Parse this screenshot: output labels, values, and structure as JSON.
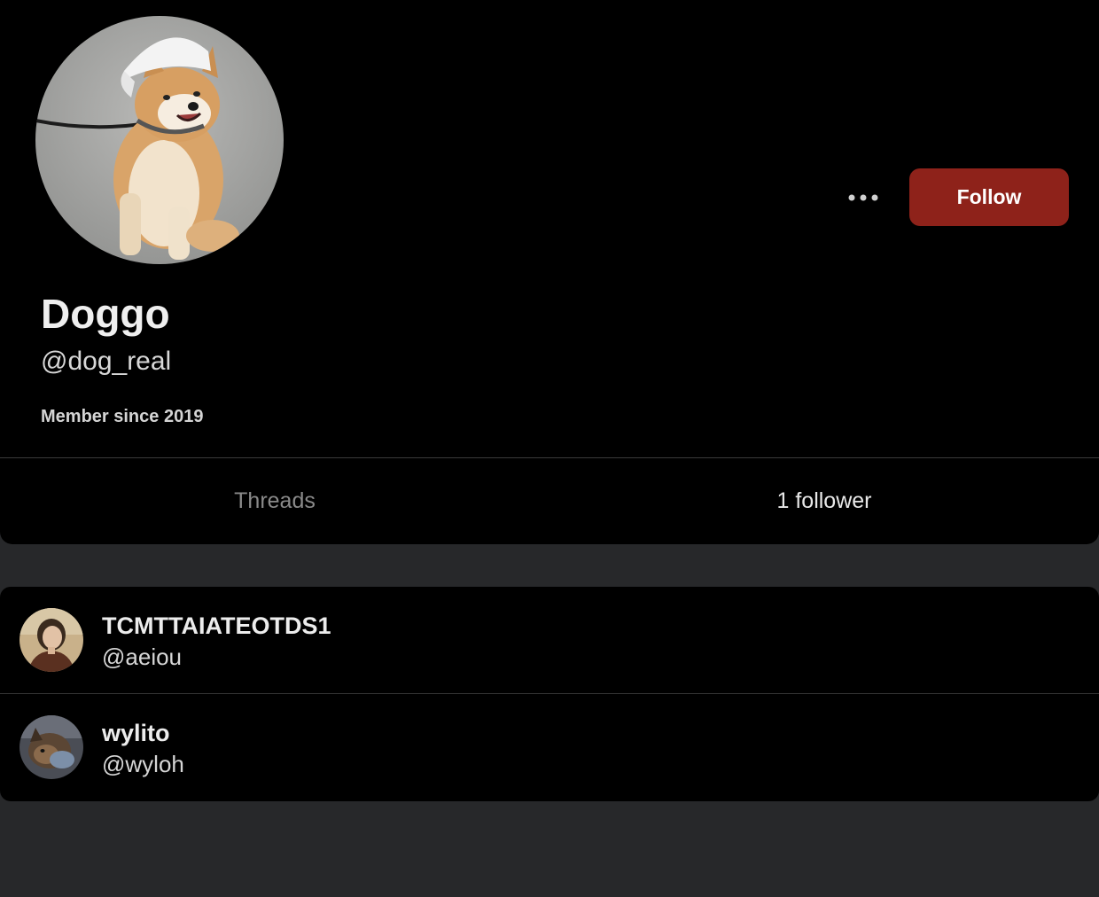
{
  "profile": {
    "avatar_icon": "shiba-dog-with-cap-photo",
    "display_name": "Doggo",
    "handle": "@dog_real",
    "member_since": "Member since 2019",
    "more_icon": "ellipsis-horizontal-icon",
    "follow_label": "Follow"
  },
  "tabs": {
    "threads_label": "Threads",
    "followers_label": "1 follower",
    "active": "followers"
  },
  "followers": [
    {
      "name": "TCMTTAIATEOTDS1",
      "handle": "@aeiou",
      "avatar_icon": "person-portrait-photo"
    },
    {
      "name": "wylito",
      "handle": "@wyloh",
      "avatar_icon": "dog-photo"
    }
  ],
  "colors": {
    "background": "#27282a",
    "card": "#000000",
    "follow_button": "#8e221a"
  }
}
